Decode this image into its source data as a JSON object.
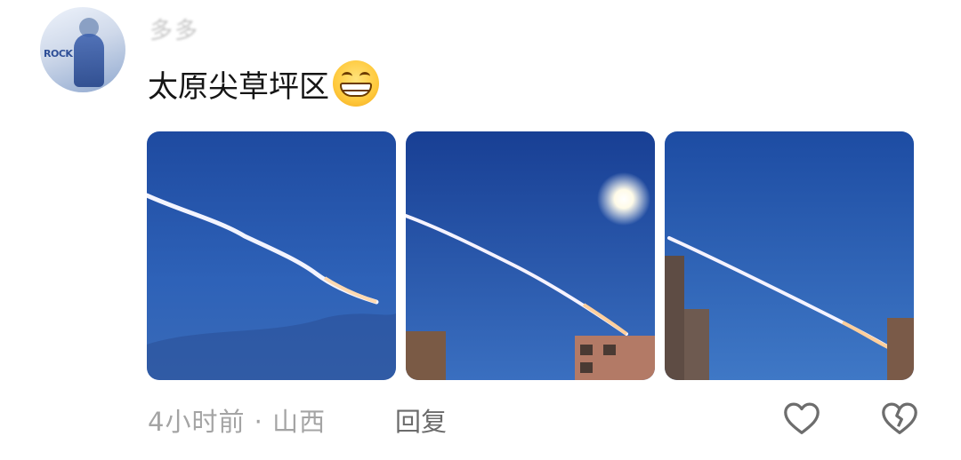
{
  "comment": {
    "username": "多多",
    "text": "太原尖草坪区",
    "emoji": "grinning-face-emoji",
    "photos": [
      {
        "name": "photo-1"
      },
      {
        "name": "photo-2"
      },
      {
        "name": "photo-3"
      }
    ],
    "time": "4小时前",
    "separator": " · ",
    "location": "山西",
    "reply_label": "回复"
  },
  "icons": {
    "like": "heart-outline-icon",
    "dislike": "broken-heart-icon"
  },
  "colors": {
    "sky_top": "#1f4fa6",
    "sky_bottom": "#3b6fc2",
    "meta_text": "#a4a4a4"
  }
}
